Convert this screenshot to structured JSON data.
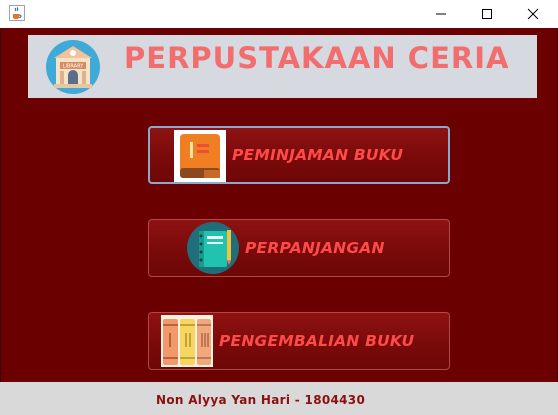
{
  "window": {
    "app_icon": "java-coffee-icon",
    "controls": [
      "minimize",
      "maximize",
      "close"
    ]
  },
  "header": {
    "title": "PERPUSTAKAAN CERIA",
    "logo_icon": "library-building-icon",
    "logo_text": "LIBRARY"
  },
  "menu": {
    "buttons": [
      {
        "label": "PEMINJAMAN BUKU",
        "icon": "closed-book-icon"
      },
      {
        "label": "PERPANJANGAN",
        "icon": "notebook-pen-icon"
      },
      {
        "label": "PENGEMBALIAN BUKU",
        "icon": "books-stack-icon"
      }
    ]
  },
  "footer": {
    "text": "Non Alyya Yan Hari - 1804430"
  },
  "colors": {
    "background": "#6b0000",
    "header_title": "#f26d6d",
    "button_label": "#ff4a4a",
    "footer_text": "#8b1010"
  }
}
